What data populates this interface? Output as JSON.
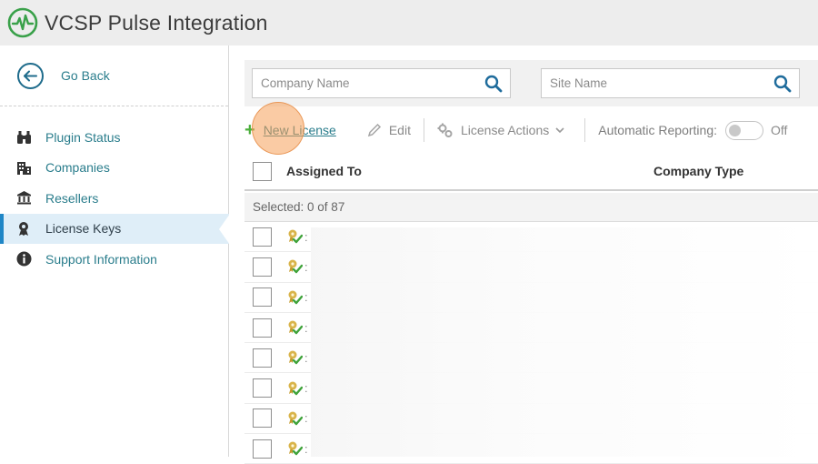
{
  "header": {
    "title": "VCSP Pulse Integration",
    "logo_icon": "pulse-logo-icon",
    "accent": "#3aa14a"
  },
  "sidebar": {
    "go_back_label": "Go Back",
    "items": [
      {
        "label": "Plugin Status",
        "icon": "binoculars-icon"
      },
      {
        "label": "Companies",
        "icon": "building-icon"
      },
      {
        "label": "Resellers",
        "icon": "bank-icon"
      },
      {
        "label": "License Keys",
        "icon": "license-key-icon",
        "active": true
      },
      {
        "label": "Support Information",
        "icon": "info-icon"
      }
    ]
  },
  "filters": {
    "company_placeholder": "Company Name",
    "site_placeholder": "Site Name"
  },
  "toolbar": {
    "new_license": "New License",
    "edit": "Edit",
    "license_actions": "License Actions",
    "automatic_reporting": "Automatic Reporting:",
    "toggle_state": "Off"
  },
  "table": {
    "columns": [
      "Assigned To",
      "Company Type"
    ],
    "selected_text": "Selected: 0 of 87",
    "row_colon": ":"
  },
  "colors": {
    "link": "#2a7d8c",
    "active_bg": "#dfeef8",
    "active_border": "#1f86c6",
    "plus": "#4caf3c"
  }
}
